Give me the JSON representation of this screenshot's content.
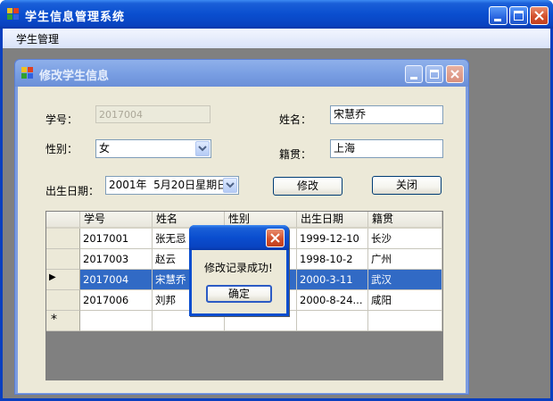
{
  "main_window": {
    "title": "学生信息管理系统",
    "menu": [
      "学生管理"
    ]
  },
  "child_window": {
    "title": "修改学生信息",
    "fields": {
      "id_label": "学号：",
      "id_value": "2017004",
      "name_label": "姓名：",
      "name_value": "宋慧乔",
      "gender_label": "性别：",
      "gender_value": "女",
      "hometown_label": "籍贯：",
      "hometown_value": "上海",
      "birth_label": "出生日期：",
      "birth_value": "2001年  5月20日星期日"
    },
    "buttons": {
      "modify": "修改",
      "close": "关闭"
    },
    "grid": {
      "columns": [
        "学号",
        "姓名",
        "性别",
        "出生日期",
        "籍贯"
      ],
      "rows": [
        [
          "2017001",
          "张无忌",
          "",
          "1999-12-10",
          "长沙"
        ],
        [
          "2017003",
          "赵云",
          "",
          "1998-10-2",
          "广州"
        ],
        [
          "2017004",
          "宋慧乔",
          "",
          "2000-3-11",
          "武汉"
        ],
        [
          "2017006",
          "刘邦",
          "",
          "2000-8-24...",
          "咸阳"
        ]
      ],
      "selected_row_marker": "▶",
      "new_row_marker": "*"
    }
  },
  "dialog": {
    "message": "修改记录成功!",
    "ok_label": "确定"
  },
  "colors": {
    "selection": "#316ac5",
    "form_bg": "#ece9d8",
    "mdi_bg": "#808080"
  }
}
